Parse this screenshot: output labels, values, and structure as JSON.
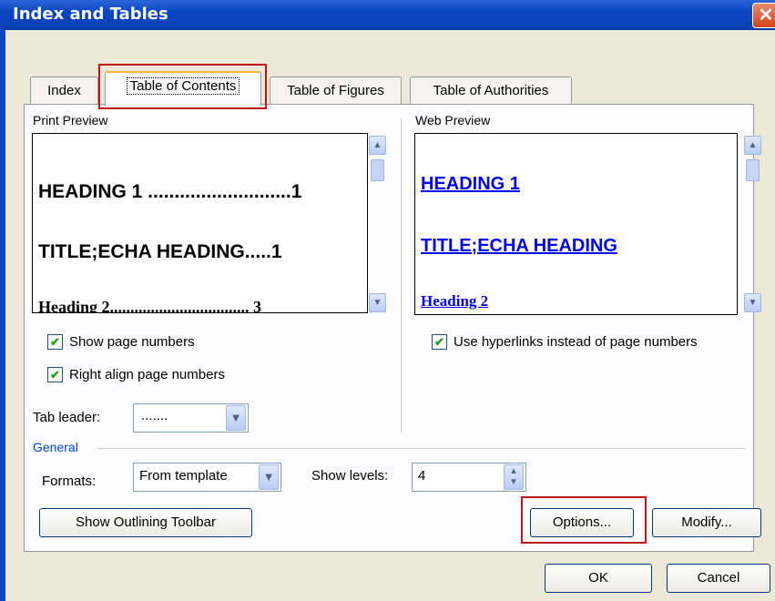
{
  "window": {
    "title": "Index and Tables",
    "close_glyph": "✕"
  },
  "tabs": [
    {
      "label": "Index",
      "mnemonic_index": 4,
      "active": false
    },
    {
      "label": "Table of Contents",
      "mnemonic_index": 9,
      "active": true
    },
    {
      "label": "Table of Figures",
      "mnemonic_index": 9,
      "active": false
    },
    {
      "label": "Table of Authorities",
      "mnemonic_index": 9,
      "active": false
    }
  ],
  "print_preview": {
    "label": "Print Preview",
    "lines": [
      {
        "text": "HEADING 1 ...........................1"
      },
      {
        "text": "TITLE;ECHA HEADING.....1"
      },
      {
        "text": "Heading 2.................................. 3"
      }
    ]
  },
  "web_preview": {
    "label": "Web Preview",
    "lines": [
      {
        "text": "HEADING 1"
      },
      {
        "text": "TITLE;ECHA HEADING"
      },
      {
        "text": "Heading 2"
      }
    ]
  },
  "options": {
    "show_page_numbers": {
      "label": "Show page numbers",
      "checked": true
    },
    "right_align": {
      "label": "Right align page numbers",
      "checked": true
    },
    "use_hyperlinks": {
      "label": "Use hyperlinks instead of page numbers",
      "checked": true
    },
    "tab_leader": {
      "label": "Tab leader:",
      "value": "......."
    }
  },
  "general": {
    "label": "General",
    "formats": {
      "label": "Formats:",
      "value": "From template"
    },
    "show_levels": {
      "label": "Show levels:",
      "value": "4"
    }
  },
  "buttons": {
    "show_outlining": "Show Outlining Toolbar",
    "options": "Options...",
    "modify": "Modify...",
    "ok": "OK",
    "cancel": "Cancel"
  },
  "icons": {
    "check": "✔",
    "up": "▲",
    "down": "▼",
    "spin_up": "▴",
    "spin_down": "▾"
  },
  "colors": {
    "titlebar": "#0a46c2",
    "highlight": "#c0171b",
    "hyperlink": "#0000ee"
  }
}
